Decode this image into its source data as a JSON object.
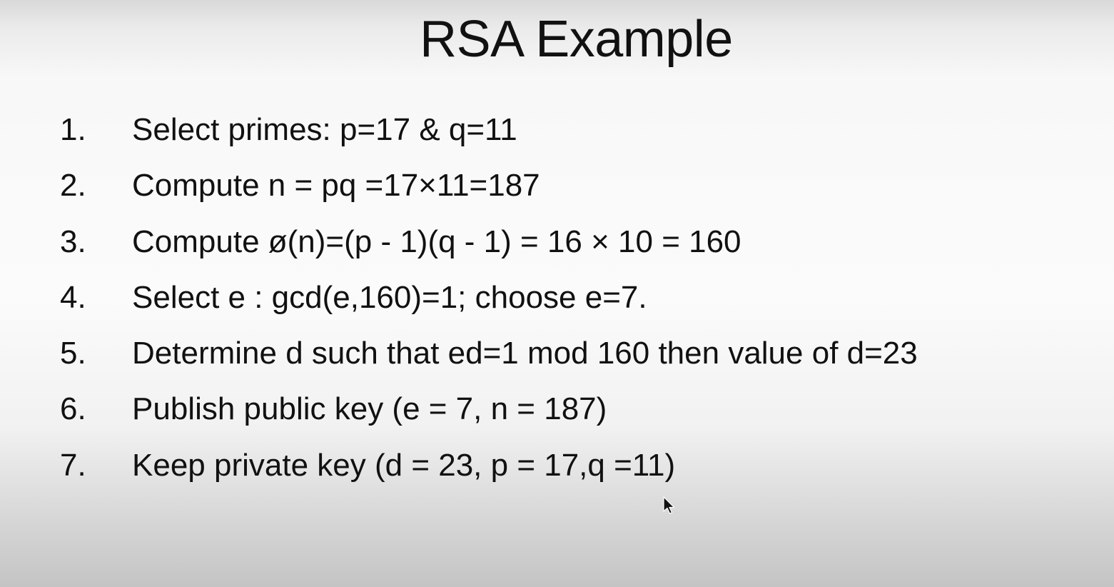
{
  "slide": {
    "title": "RSA Example",
    "steps": [
      {
        "number": "1.",
        "text": "Select primes: p=17 & q=11"
      },
      {
        "number": "2.",
        "text": "Compute n = pq =17×11=187"
      },
      {
        "number": "3.",
        "text": "Compute ø(n)=(p - 1)(q - 1) = 16 × 10 = 160"
      },
      {
        "number": "4.",
        "text": "Select e : gcd(e,160)=1; choose e=7."
      },
      {
        "number": "5.",
        "text": "Determine d such that ed=1 mod 160 then value of d=23"
      },
      {
        "number": "6.",
        "text": "Publish public key (e = 7, n = 187)"
      },
      {
        "number": "7.",
        "text": "Keep private key (d = 23, p = 17,q =11)"
      }
    ]
  },
  "cursor": {
    "icon": "mouse-pointer-icon"
  }
}
